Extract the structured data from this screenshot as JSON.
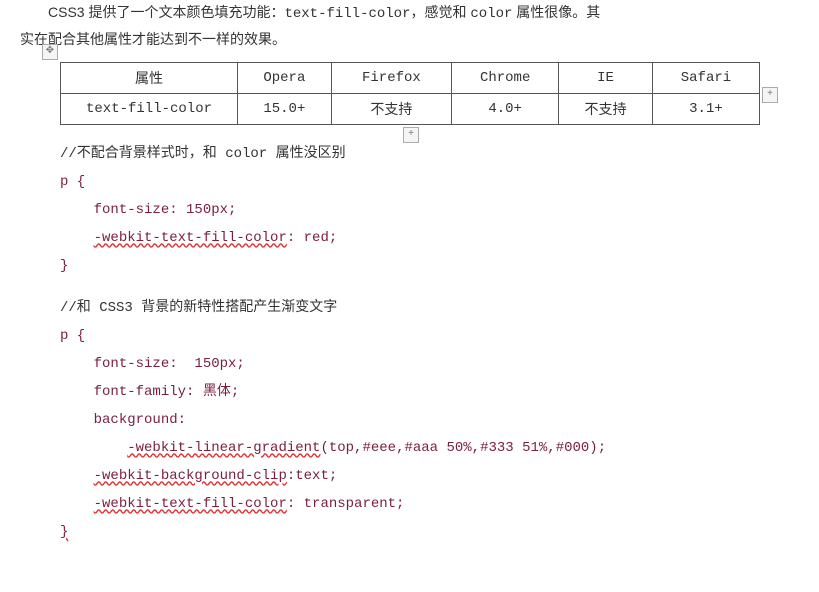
{
  "intro": {
    "line1_prefix": "CSS3 提供了一个文本颜色填充功能：",
    "prop": "text-fill-color",
    "line1_mid": "，感觉和 ",
    "colorword": "color",
    "line1_suffix": " 属性很像。其",
    "line2": "实在配合其他属性才能达到不一样的效果。"
  },
  "table": {
    "headers": [
      "属性",
      "Opera",
      "Firefox",
      "Chrome",
      "IE",
      "Safari"
    ],
    "row": [
      "text-fill-color",
      "15.0+",
      "不支持",
      "4.0+",
      "不支持",
      "3.1+"
    ]
  },
  "handles": {
    "move": "✥",
    "plus": "+"
  },
  "code": {
    "c1": "//不配合背景样式时，和 color 属性没区别",
    "p_open": "p {",
    "fs150": "font-size: 150px;",
    "wtfc_red": "-webkit-text-fill-color",
    "wtfc_red_val": ": red;",
    "brace_close": "}",
    "c2": "//和 CSS3 背景的新特性搭配产生渐变文字",
    "fs150b": "font-size:  150px;",
    "ff": "font-family: 黑体;",
    "bg": "background:",
    "grad_fn": "-webkit-linear-gradient",
    "grad_args": "(top,#eee,#aaa 50%,#333 51%,#000);",
    "bgclip": "-webkit-background-clip",
    "bgclip_val": ":text;",
    "wtfc_t": "-webkit-text-fill-color",
    "wtfc_t_val": ": transparent;"
  }
}
